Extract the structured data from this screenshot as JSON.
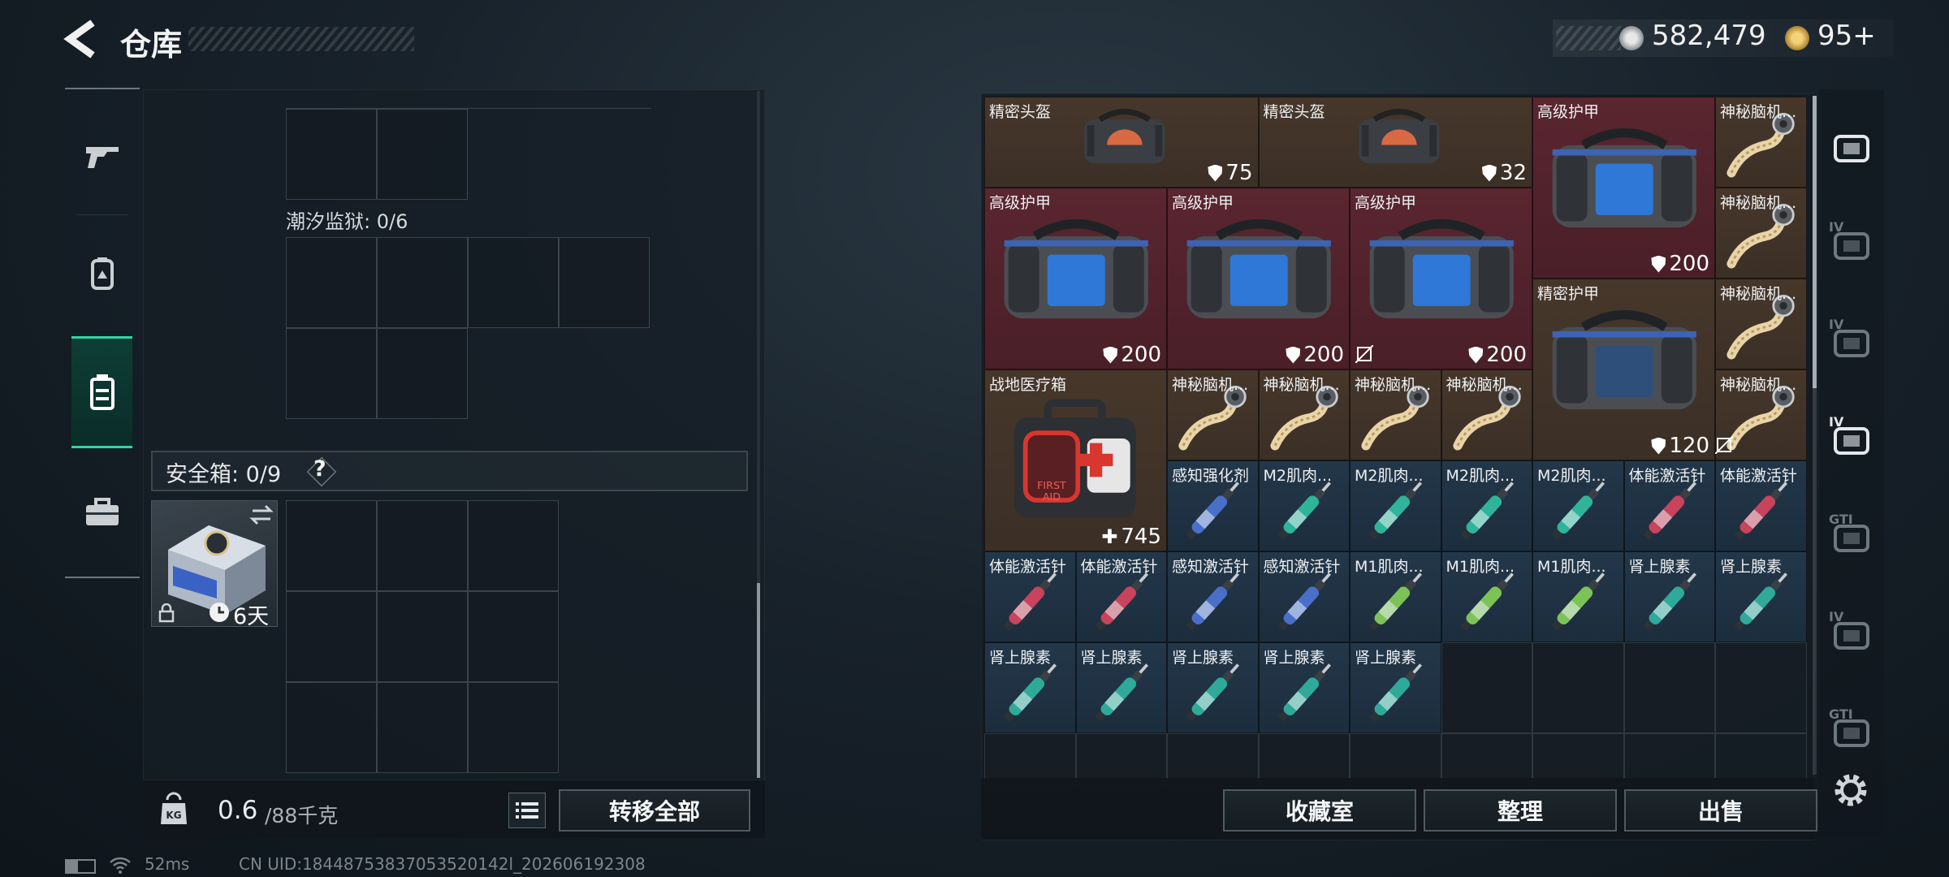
{
  "header": {
    "title": "仓库"
  },
  "currency": {
    "coins": "582,479",
    "tokens": "95+"
  },
  "left_tabs": [
    {
      "icon": "gun-icon",
      "active": false
    },
    {
      "icon": "backpack-icon",
      "active": false
    },
    {
      "icon": "vest-icon",
      "active": true
    },
    {
      "icon": "case-icon",
      "active": false
    }
  ],
  "storage": {
    "section_prison": "潮汐监狱: 0/6",
    "safe_label": "安全箱: 0/9",
    "help": "?",
    "safebox_timer": "6天"
  },
  "weight": {
    "current": "0.6",
    "max": "/88千克",
    "icon_label": "KG"
  },
  "buttons": {
    "transfer_all": "转移全部",
    "collection": "收藏室",
    "sort": "整理",
    "sell": "出售"
  },
  "inventory": [
    {
      "name": "精密头盔",
      "value": "75",
      "type": "helmet",
      "bg": "brown"
    },
    {
      "name": "精密头盔",
      "value": "32",
      "type": "helmet",
      "bg": "brown"
    },
    {
      "name": "高级护甲",
      "value": "200",
      "type": "armor",
      "bg": "red"
    },
    {
      "name": "神秘脑机...",
      "type": "cable",
      "bg": "brown"
    },
    {
      "name": "神秘脑机...",
      "type": "cable",
      "bg": "brown"
    },
    {
      "name": "高级护甲",
      "value": "200",
      "type": "armor",
      "bg": "red"
    },
    {
      "name": "高级护甲",
      "value": "200",
      "type": "armor",
      "bg": "red"
    },
    {
      "name": "高级护甲",
      "value": "200",
      "type": "armor",
      "bg": "red"
    },
    {
      "name": "精密护甲",
      "value": "120",
      "type": "armor-dark",
      "bg": "brown"
    },
    {
      "name": "神秘脑机...",
      "type": "cable",
      "bg": "brown"
    },
    {
      "name": "神秘脑机...",
      "type": "cable",
      "bg": "brown"
    },
    {
      "name": "战地医疗箱",
      "value": "745",
      "type": "medkit",
      "bg": "brown"
    },
    {
      "name": "神秘脑机...",
      "type": "cable",
      "bg": "brown"
    },
    {
      "name": "神秘脑机...",
      "type": "cable",
      "bg": "brown"
    },
    {
      "name": "神秘脑机...",
      "type": "cable",
      "bg": "brown"
    },
    {
      "name": "神秘脑机...",
      "type": "cable",
      "bg": "brown"
    },
    {
      "name": "感知强化剂",
      "type": "syringe",
      "color": "#4a6fc9",
      "bg": "blue"
    },
    {
      "name": "M2肌肉...",
      "type": "syringe",
      "color": "#2fb39a",
      "bg": "blue"
    },
    {
      "name": "M2肌肉...",
      "type": "syringe",
      "color": "#2fb39a",
      "bg": "blue"
    },
    {
      "name": "M2肌肉...",
      "type": "syringe",
      "color": "#2fb39a",
      "bg": "blue"
    },
    {
      "name": "M2肌肉...",
      "type": "syringe",
      "color": "#2fb39a",
      "bg": "blue"
    },
    {
      "name": "体能激活针",
      "type": "syringe",
      "color": "#c8435c",
      "bg": "blue"
    },
    {
      "name": "体能激活针",
      "type": "syringe",
      "color": "#c8435c",
      "bg": "blue"
    },
    {
      "name": "体能激活针",
      "type": "syringe",
      "color": "#c8435c",
      "bg": "blue"
    },
    {
      "name": "体能激活针",
      "type": "syringe",
      "color": "#c8435c",
      "bg": "blue"
    },
    {
      "name": "感知激活针",
      "type": "syringe",
      "color": "#4a6fc9",
      "bg": "blue"
    },
    {
      "name": "感知激活针",
      "type": "syringe",
      "color": "#4a6fc9",
      "bg": "blue"
    },
    {
      "name": "M1肌肉...",
      "type": "syringe",
      "color": "#7cc357",
      "bg": "blue"
    },
    {
      "name": "M1肌肉...",
      "type": "syringe",
      "color": "#7cc357",
      "bg": "blue"
    },
    {
      "name": "M1肌肉...",
      "type": "syringe",
      "color": "#7cc357",
      "bg": "blue"
    },
    {
      "name": "肾上腺素",
      "type": "syringe",
      "color": "#2fa99a",
      "bg": "blue"
    },
    {
      "name": "肾上腺素",
      "type": "syringe",
      "color": "#2fa99a",
      "bg": "blue"
    },
    {
      "name": "肾上腺素",
      "type": "syringe",
      "color": "#2fa99a",
      "bg": "blue"
    },
    {
      "name": "肾上腺素",
      "type": "syringe",
      "color": "#2fa99a",
      "bg": "blue"
    },
    {
      "name": "肾上腺素",
      "type": "syringe",
      "color": "#2fa99a",
      "bg": "blue"
    },
    {
      "name": "肾上腺素",
      "type": "syringe",
      "color": "#2fa99a",
      "bg": "blue"
    },
    {
      "name": "肾上腺素",
      "type": "syringe",
      "color": "#2fa99a",
      "bg": "blue"
    }
  ],
  "right_tabs": [
    {
      "icon": "helmet-slot-icon",
      "label": ""
    },
    {
      "icon": "vest-slot-icon",
      "label": "IV"
    },
    {
      "icon": "rig-slot-icon",
      "label": "IV"
    },
    {
      "icon": "medkit-slot-icon",
      "label": "IV"
    },
    {
      "icon": "armor-slot-icon",
      "label": "GTI"
    },
    {
      "icon": "backpack-slot-icon",
      "label": "IV"
    },
    {
      "icon": "weapon-slot-icon",
      "label": "GTI"
    }
  ],
  "status": {
    "ping": "52ms",
    "uid": "CN UID:18448753837053520142l_202606192308"
  },
  "colors": {
    "accent": "#2fd6a4",
    "item_brown": "#47372b",
    "item_red": "#5a2630",
    "item_blue": "#23374a"
  }
}
